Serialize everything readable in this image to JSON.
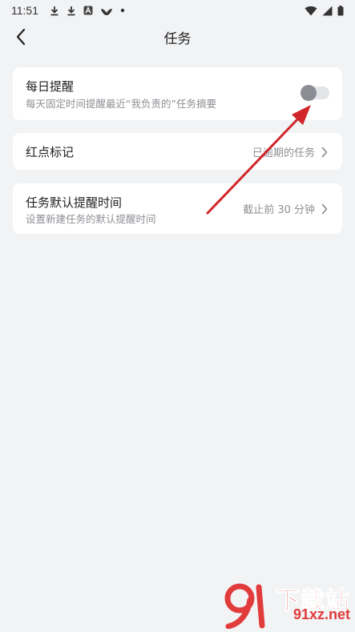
{
  "status_bar": {
    "time": "11:51",
    "left_icons": [
      "download-icon",
      "download-icon",
      "app-a-icon",
      "app-bird-icon",
      "dot-icon"
    ],
    "right_icons": [
      "wifi-icon",
      "signal-icon",
      "battery-icon"
    ]
  },
  "nav": {
    "title": "任务",
    "back_icon": "chevron-left-icon"
  },
  "settings": {
    "daily_reminder": {
      "title": "每日提醒",
      "subtitle": "每天固定时间提醒最近“我负责的”任务摘要",
      "toggle_on": false
    },
    "red_mark": {
      "title": "红点标记",
      "value": "已逾期的任务"
    },
    "default_reminder_time": {
      "title": "任务默认提醒时间",
      "subtitle": "设置新建任务的默认提醒时间",
      "value": "截止前 30 分钟"
    }
  },
  "watermark": {
    "brand_cn": "下载站",
    "url": "91xz.net"
  },
  "colors": {
    "background": "#f2f3f5",
    "card": "#ffffff",
    "annotation_arrow": "#d0252a",
    "toggle_knob": "#8a8d93",
    "watermark": "#e23b3b"
  }
}
